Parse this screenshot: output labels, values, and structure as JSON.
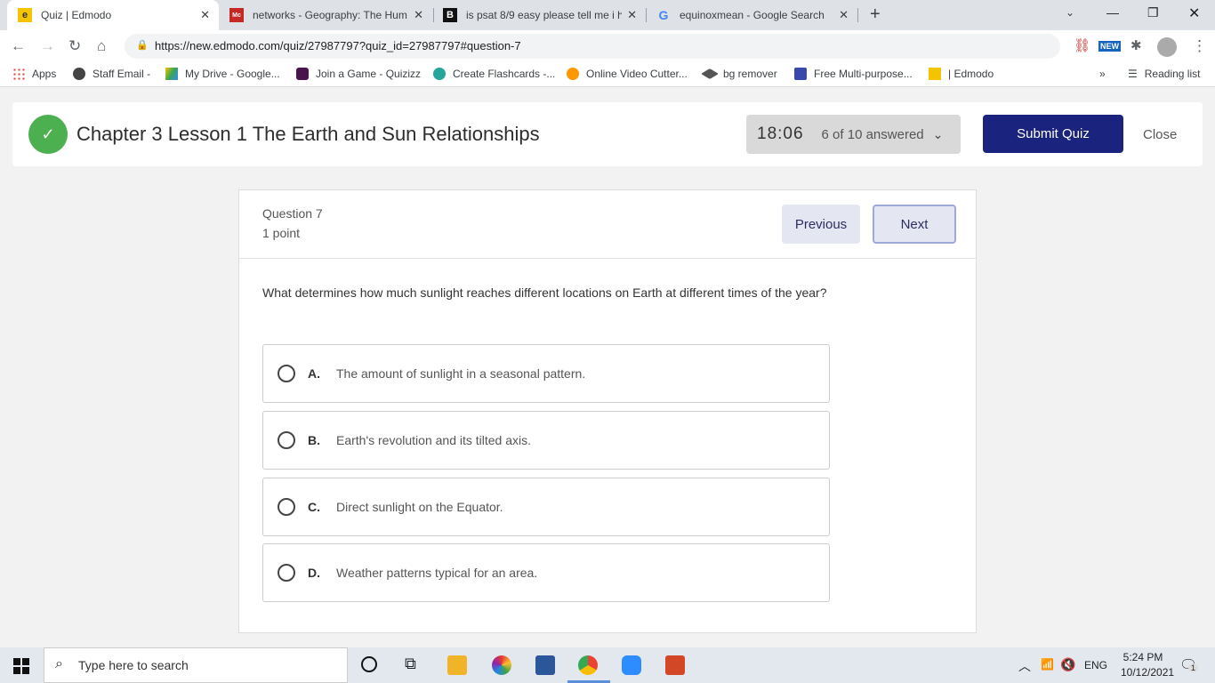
{
  "browser": {
    "tabs": [
      {
        "title": "Quiz | Edmodo",
        "active": true
      },
      {
        "title": "networks - Geography: The Hum"
      },
      {
        "title": "is psat 8/9 easy please tell me i h"
      },
      {
        "title": "equinoxmean - Google Search"
      }
    ],
    "url": "https://new.edmodo.com/quiz/27987797?quiz_id=27987797#question-7",
    "bookmarks": [
      "Apps",
      "Staff Email -",
      "My Drive - Google...",
      "Join a Game - Quizizz",
      "Create Flashcards -...",
      "Online Video Cutter...",
      "bg remover",
      "Free Multi-purpose...",
      "| Edmodo"
    ],
    "reading_list": "Reading list",
    "ext_badge": "NEW"
  },
  "quiz": {
    "title": "Chapter 3 Lesson 1 The Earth and Sun Relationships",
    "timer": "18:06",
    "answered": "6 of 10 answered",
    "submit": "Submit Quiz",
    "close": "Close",
    "question_number": "Question 7",
    "points": "1 point",
    "previous": "Previous",
    "next": "Next",
    "question": "What determines how much sunlight reaches different locations on Earth at different times of the year?",
    "options": [
      {
        "letter": "A.",
        "text": "The amount of sunlight in a seasonal pattern."
      },
      {
        "letter": "B.",
        "text": "Earth's revolution and its tilted axis."
      },
      {
        "letter": "C.",
        "text": "Direct sunlight on the Equator."
      },
      {
        "letter": "D.",
        "text": "Weather patterns typical for an area."
      }
    ]
  },
  "taskbar": {
    "search_placeholder": "Type here to search",
    "lang": "ENG",
    "time": "5:24 PM",
    "date": "10/12/2021",
    "notifications": "1"
  }
}
